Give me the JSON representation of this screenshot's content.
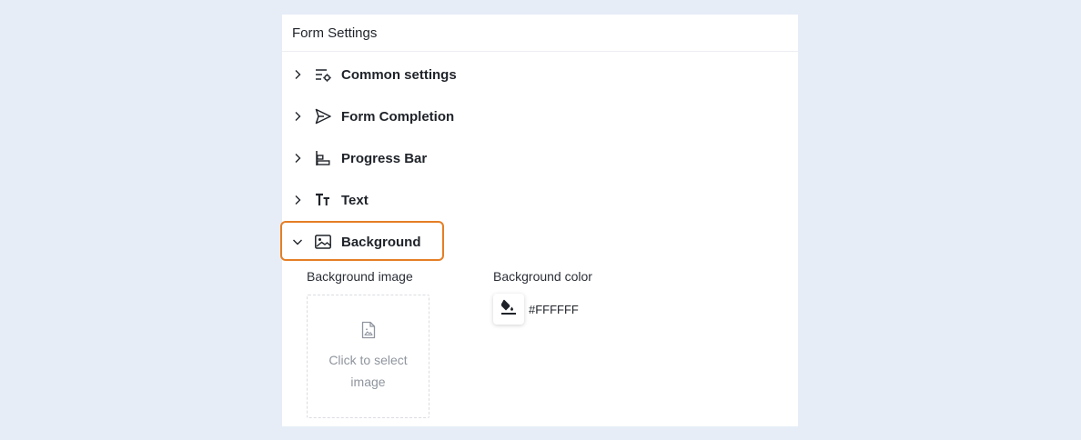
{
  "panel": {
    "title": "Form Settings"
  },
  "sections": [
    {
      "label": "Common settings",
      "icon": "list-settings-icon",
      "expanded": false
    },
    {
      "label": "Form Completion",
      "icon": "send-icon",
      "expanded": false
    },
    {
      "label": "Progress Bar",
      "icon": "progress-bar-icon",
      "expanded": false
    },
    {
      "label": "Text",
      "icon": "text-icon",
      "expanded": false
    },
    {
      "label": "Background",
      "icon": "image-icon",
      "expanded": true
    }
  ],
  "background": {
    "image_label": "Background image",
    "upload_text": "Click to select image",
    "color_label": "Background color",
    "color_value": "#FFFFFF"
  },
  "colors": {
    "page_bg": "#e6edf7",
    "active_border": "#e57e25",
    "muted_text": "#8f959e"
  }
}
